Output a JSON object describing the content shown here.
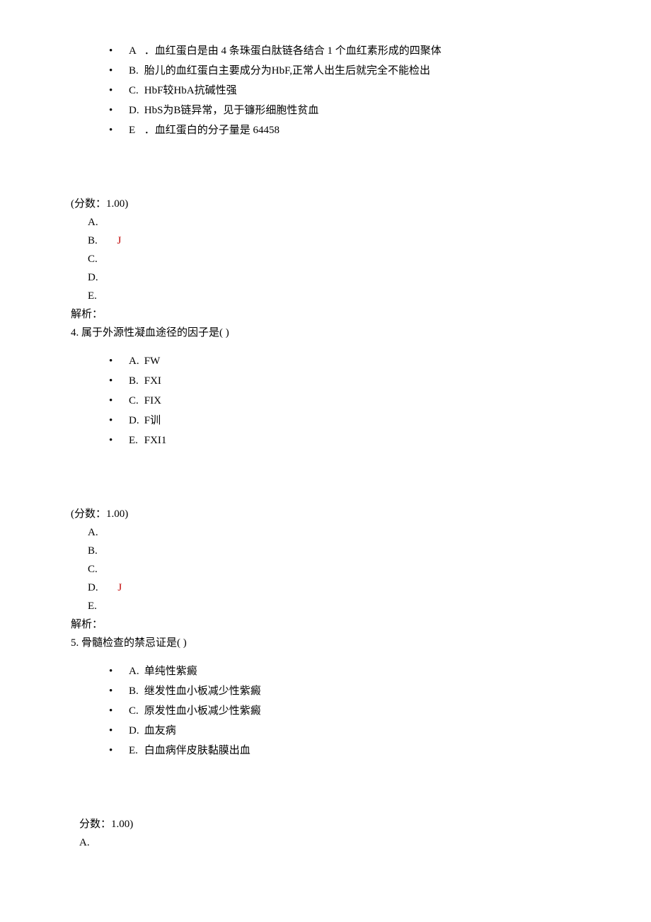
{
  "q3": {
    "options": [
      {
        "label": "A",
        "text": "．血红蛋白是由 4 条珠蛋白肽链各结合 1 个血红素形成的四聚体"
      },
      {
        "label": "B.",
        "text": "胎儿的血红蛋白主要成分为HbF,正常人出生后就完全不能检出"
      },
      {
        "label": "C.",
        "text": "HbF较HbA抗碱性强"
      },
      {
        "label": "D.",
        "text": "HbS为B链异常，见于镰形细胞性贫血"
      },
      {
        "label": "E",
        "text": "．血红蛋白的分子量是 64458"
      }
    ],
    "score": "(分数：1.00)",
    "choices": [
      "A.",
      "B.",
      "C.",
      "D.",
      "E."
    ],
    "correct_index": 1,
    "check_symbol": "J",
    "analysis": "解析："
  },
  "q4": {
    "stem": "4. 属于外源性凝血途径的因子是( )",
    "options": [
      {
        "label": "A.",
        "text": "FW"
      },
      {
        "label": "B.",
        "text": "FXI"
      },
      {
        "label": "C.",
        "text": "FIX"
      },
      {
        "label": "D.",
        "text": "F训"
      },
      {
        "label": "E.",
        "text": "FXI1"
      }
    ],
    "score": "(分数：1.00)",
    "choices": [
      "A.",
      "B.",
      "C.",
      "D.",
      "E."
    ],
    "correct_index": 3,
    "check_symbol": "J",
    "analysis": "解析："
  },
  "q5": {
    "stem": "5. 骨髓检查的禁忌证是( )",
    "options": [
      {
        "label": "A.",
        "text": "单纯性紫癜"
      },
      {
        "label": "B.",
        "text": "继发性血小板减少性紫癜"
      },
      {
        "label": "C.",
        "text": "原发性血小板减少性紫癜"
      },
      {
        "label": "D.",
        "text": "血友病"
      },
      {
        "label": "E.",
        "text": "白血病伴皮肤黏膜出血"
      }
    ],
    "score": "分数：1.00)",
    "choice_a": "A."
  }
}
